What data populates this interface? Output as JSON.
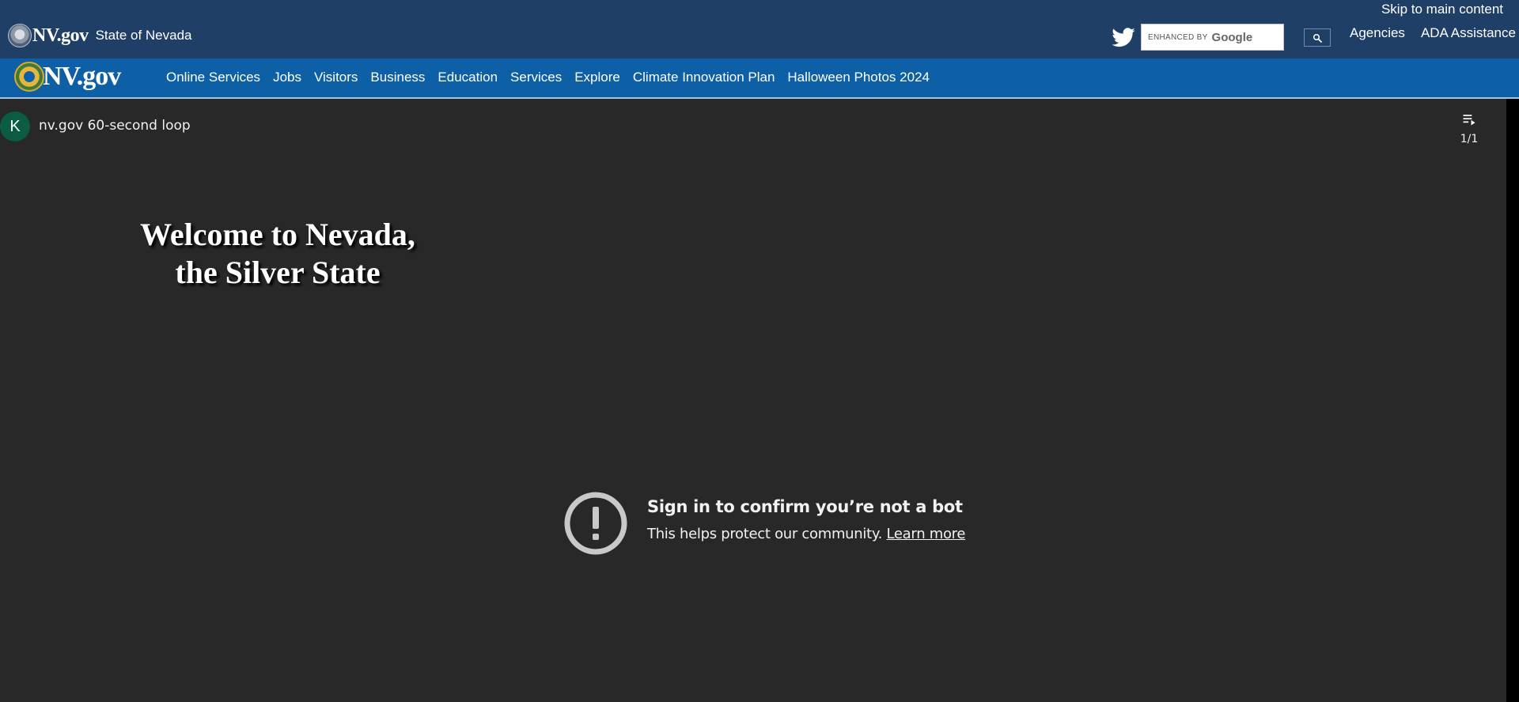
{
  "topbar": {
    "skip_link": "Skip to main content",
    "logo_text": "NV.gov",
    "state_name": "State of Nevada",
    "search": {
      "enhanced_by": "ENHANCED BY",
      "google": "Google",
      "value": ""
    },
    "links": [
      "Agencies",
      "ADA Assistance"
    ],
    "icons": {
      "social": "twitter-icon",
      "search": "search-icon"
    }
  },
  "mainnav": {
    "logo_text": "NV.gov",
    "items": [
      "Online Services",
      "Jobs",
      "Visitors",
      "Business",
      "Education",
      "Services",
      "Explore",
      "Climate Innovation Plan",
      "Halloween Photos 2024"
    ]
  },
  "video": {
    "channel_initial": "K",
    "title": "nv.gov 60-second loop",
    "playlist_count": "1/1",
    "overlay_line1": "Welcome to Nevada,",
    "overlay_line2": "the Silver State",
    "bot_heading": "Sign in to confirm you’re not a bot",
    "bot_text": "This helps protect our community.",
    "learn_more": "Learn more"
  },
  "colors": {
    "topbar_bg": "#1f3f67",
    "nav_bg": "#0d5fa6",
    "video_bg": "#282828",
    "avatar_bg": "#0b5c44"
  }
}
